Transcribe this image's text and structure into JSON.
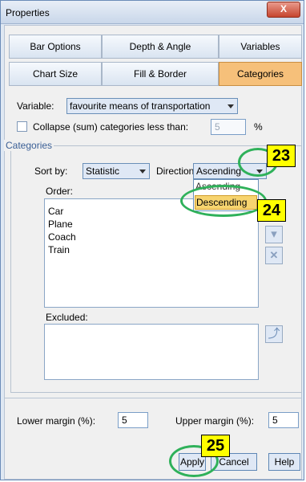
{
  "window": {
    "title": "Properties",
    "close_glyph": "X"
  },
  "tabs_row1": [
    {
      "label": "Bar Options"
    },
    {
      "label": "Depth & Angle"
    },
    {
      "label": "Variables"
    }
  ],
  "tabs_row2": [
    {
      "label": "Chart Size"
    },
    {
      "label": "Fill & Border"
    },
    {
      "label": "Categories"
    }
  ],
  "variable": {
    "label": "Variable:",
    "value": "favourite means of transportation"
  },
  "collapse": {
    "label": "Collapse (sum) categories less than:",
    "value": "5",
    "unit": "%",
    "checked": false
  },
  "categories_group": {
    "label": "Categories"
  },
  "sort": {
    "label": "Sort by:",
    "value": "Statistic",
    "direction_label": "Direction:",
    "direction_value": "Ascending",
    "dropdown_options": [
      "Ascending",
      "Descending"
    ],
    "highlighted_option": "Descending"
  },
  "order": {
    "label": "Order:",
    "items": [
      "Car",
      "Plane",
      "Coach",
      "Train"
    ]
  },
  "excluded": {
    "label": "Excluded:"
  },
  "margins": {
    "lower_label": "Lower margin (%):",
    "lower_value": "5",
    "upper_label": "Upper margin (%):",
    "upper_value": "5"
  },
  "buttons": {
    "apply": "Apply",
    "cancel": "Cancel",
    "help": "Help"
  },
  "annotations": [
    "23",
    "24",
    "25"
  ],
  "colors": {
    "active_tab": "#f6c07a",
    "annotation_circle": "#2fb15a",
    "annotation_badge": "#ffff00",
    "highlight": "#f7d46f"
  },
  "icons": {
    "move_down": "down-arrow-icon",
    "remove": "x-icon",
    "restore": "up-arrow-icon"
  }
}
